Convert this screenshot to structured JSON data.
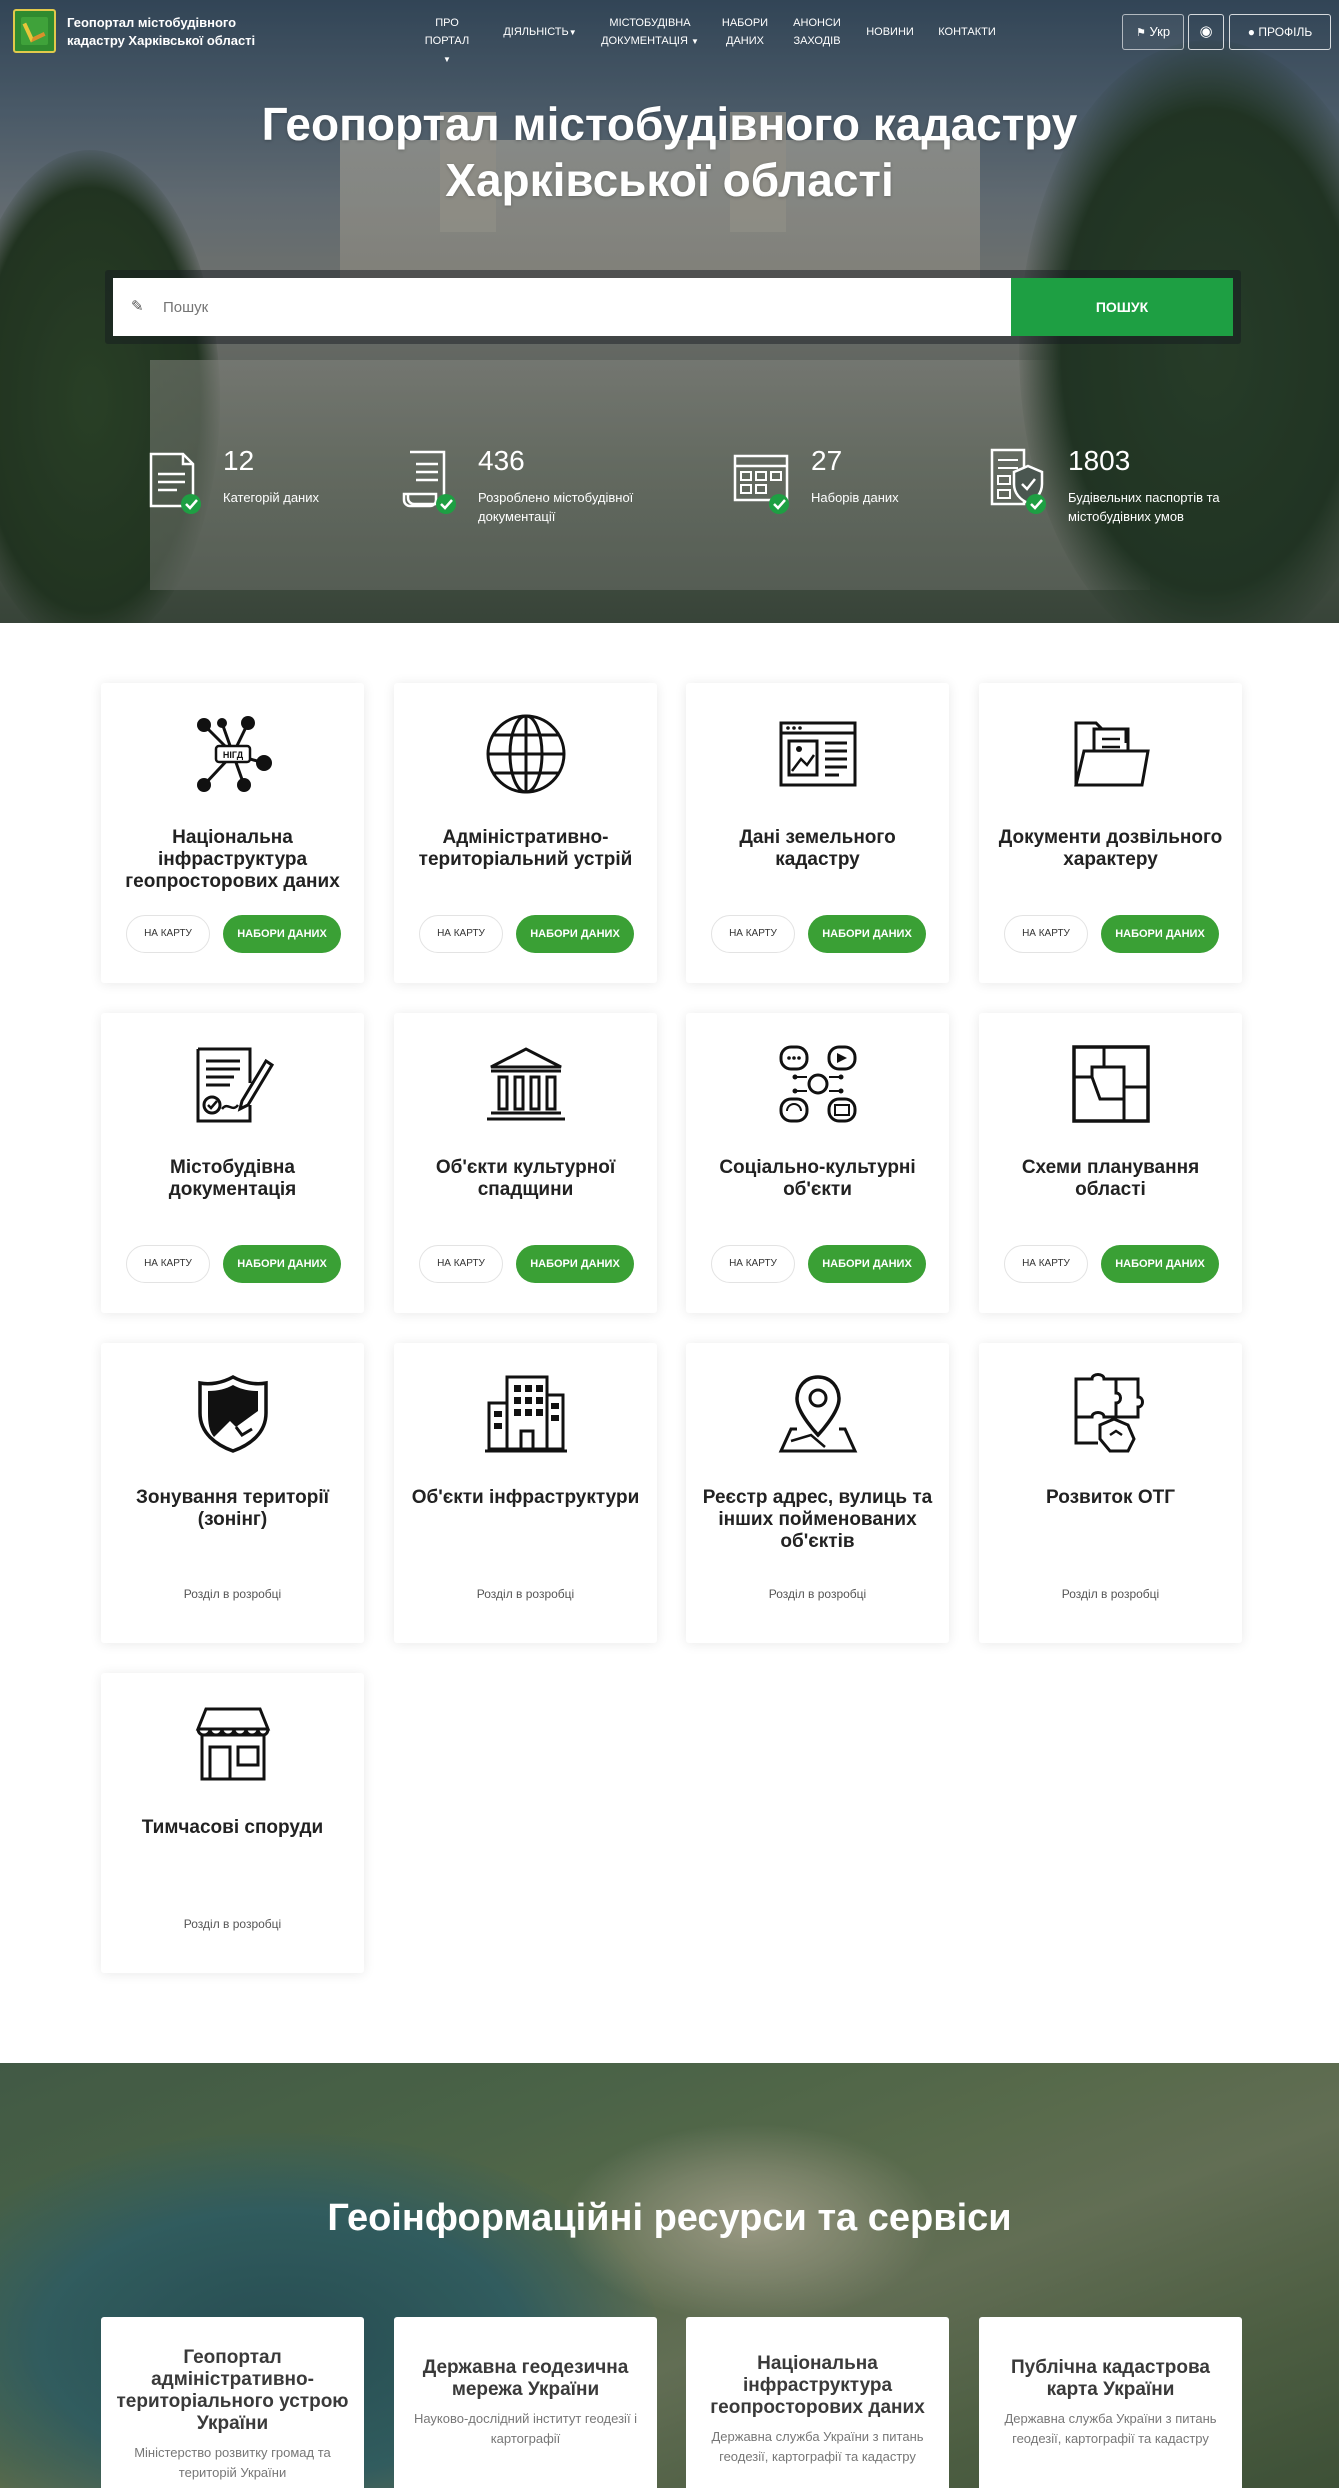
{
  "header": {
    "site_name": "Геопортал містобудівного кадастру Харківської області",
    "menu": [
      {
        "label": "Про портал",
        "caret": true
      },
      {
        "label": "Діяльність",
        "caret": true
      },
      {
        "label": "Містобудівна документація",
        "caret": true
      },
      {
        "label": "Набори даних",
        "caret": false
      },
      {
        "label": "Анонси заходів",
        "caret": false
      },
      {
        "label": "Новини",
        "caret": false
      },
      {
        "label": "Контакти",
        "caret": false
      }
    ],
    "lang_label": "Укр",
    "profile_label": "ПРОФІЛЬ"
  },
  "hero": {
    "title": "Геопортал містобудівного кадастру Харківської області",
    "search_placeholder": "Пошук",
    "search_value": "",
    "search_button": "ПОШУК"
  },
  "stats": [
    {
      "value": "12",
      "label": "Категорій даних",
      "icon": "document-check-icon"
    },
    {
      "value": "436",
      "label": "Розроблено містобудівної документації",
      "icon": "scroll-check-icon"
    },
    {
      "value": "27",
      "label": "Наборів даних",
      "icon": "calendar-check-icon"
    },
    {
      "value": "1803",
      "label": "Будівельних паспортів та містобудівних умов",
      "icon": "shield-documents-icon"
    }
  ],
  "categories": {
    "map_label": "на карту",
    "data_label": "набори даних",
    "dev_label": "Розділ в розробці",
    "items": [
      {
        "title": "Національна інфраструктура геопросторових даних",
        "icon": "nsdi-network-icon",
        "nsdi_text": "НІГД",
        "active": true
      },
      {
        "title": "Адміністративно-територіальний устрій",
        "icon": "globe-icon",
        "active": true
      },
      {
        "title": "Дані земельного кадастру",
        "icon": "land-registry-icon",
        "active": true
      },
      {
        "title": "Документи дозвільного характеру",
        "icon": "folder-documents-icon",
        "active": true
      },
      {
        "title": "Містобудівна документація",
        "icon": "signed-document-icon",
        "active": true
      },
      {
        "title": "Об'єкти культурної спадщини",
        "icon": "museum-icon",
        "active": true
      },
      {
        "title": "Соціально-культурні об'єкти",
        "icon": "social-services-icon",
        "active": true
      },
      {
        "title": "Схеми планування області",
        "icon": "floor-plan-icon",
        "active": true
      },
      {
        "title": "Зонування території (зонінг)",
        "icon": "zoning-shield-icon",
        "active": false
      },
      {
        "title": "Об'єкти інфраструктури",
        "icon": "buildings-icon",
        "active": false
      },
      {
        "title": "Реєстр адрес, вулиць та інших пойменованих об'єктів",
        "icon": "map-pin-icon",
        "active": false
      },
      {
        "title": "Розвиток ОТГ",
        "icon": "puzzle-icon",
        "active": false
      },
      {
        "title": "Тимчасові споруди",
        "icon": "kiosk-icon",
        "active": false
      }
    ]
  },
  "resources": {
    "title": "Геоінформаційні ресурси та сервіси",
    "items": [
      {
        "title": "Геопортал адміністративно-територіального устрою України",
        "subtitle": "Міністерство розвитку громад та територій України"
      },
      {
        "title": "Державна геодезична мережа України",
        "subtitle": "Науково-дослідний інститут геодезії і картографії"
      },
      {
        "title": "Національна інфраструктура геопросторових даних",
        "subtitle": "Державна служба України з питань геодезії, картографії та кадастру"
      },
      {
        "title": "Публічна кадастрова карта України",
        "subtitle": "Державна служба України з питань геодезії, картографії та кадастру"
      }
    ]
  },
  "colors": {
    "accent_green": "#3aa035",
    "search_green": "#1e9f43"
  }
}
